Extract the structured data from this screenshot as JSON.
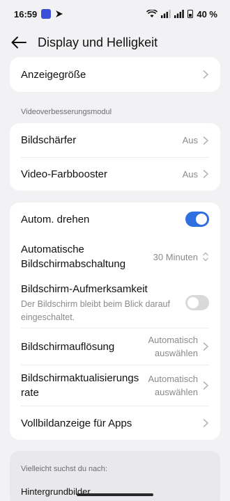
{
  "status_bar": {
    "time": "16:59",
    "battery_percent": "40 %",
    "icons": [
      "app-notification-icon",
      "navigation-icon",
      "wifi-icon",
      "signal-icon",
      "signal-icon",
      "battery-icon"
    ]
  },
  "app_bar": {
    "title": "Display und Helligkeit"
  },
  "card_top": {
    "item": "Anzeigegröße"
  },
  "video_section": {
    "header": "Videoverbesserungsmodul",
    "items": [
      {
        "label": "Bildschärfer",
        "value": "Aus"
      },
      {
        "label": "Video-Farbbooster",
        "value": "Aus"
      }
    ]
  },
  "main_card": {
    "auto_rotate": {
      "label": "Autom. drehen",
      "enabled": true
    },
    "screen_timeout": {
      "label_line1": "Automatische",
      "label_line2": "Bildschirmabschaltung",
      "value": "30 Minuten"
    },
    "attention": {
      "label": "Bildschirm-Aufmerksamkeit",
      "sub_line1": "Der Bildschirm bleibt beim Blick darauf",
      "sub_line2": "eingeschaltet.",
      "enabled": false
    },
    "resolution": {
      "label": "Bildschirmauflösung",
      "value_line1": "Automatisch",
      "value_line2": "auswählen"
    },
    "refresh": {
      "label_line1": "Bildschirmaktualisierungs",
      "label_line2": "rate",
      "value_line1": "Automatisch",
      "value_line2": "auswählen"
    },
    "fullscreen": {
      "label": "Vollbildanzeige für Apps"
    }
  },
  "suggestions": {
    "header": "Vielleicht suchst du nach:",
    "item": "Hintergrundbilder"
  },
  "colors": {
    "accent": "#2f6fe0",
    "background": "#f2f2f4",
    "card": "#ffffff"
  }
}
